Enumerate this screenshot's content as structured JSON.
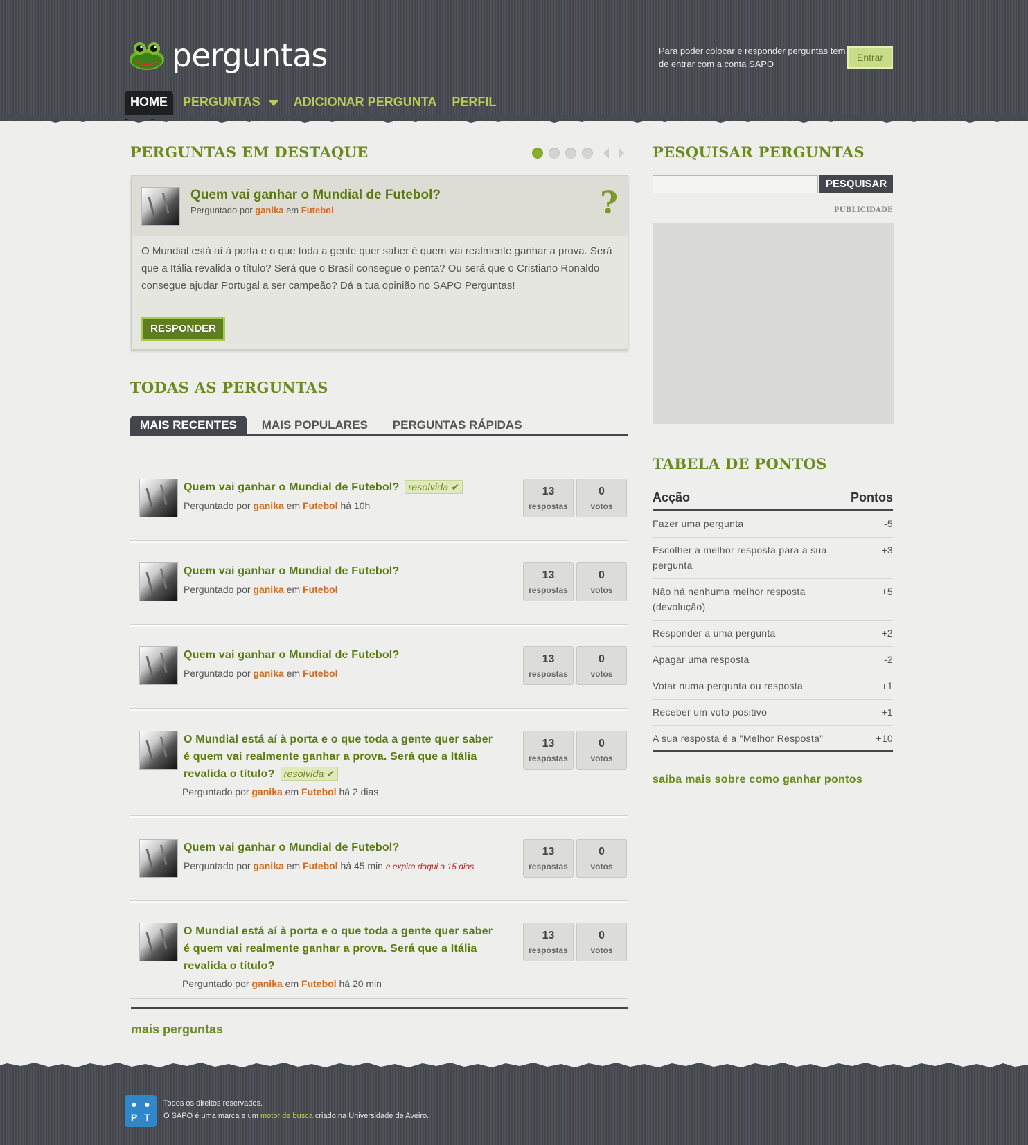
{
  "header": {
    "logo_text": "perguntas",
    "login_message": "Para poder colocar e responder perguntas tem de entrar com a conta SAPO",
    "login_button": "Entrar",
    "nav": [
      {
        "label": "HOME"
      },
      {
        "label": "PERGUNTAS"
      },
      {
        "label": "ADICIONAR PERGUNTA"
      },
      {
        "label": "PERFIL"
      }
    ]
  },
  "featured": {
    "section_title": "PERGUNTAS EM DESTAQUE",
    "title": "Quem vai ganhar o Mundial de Futebol?",
    "meta_prefix": "Perguntado por",
    "user": "ganika",
    "meta_in": "em",
    "category": "Futebol",
    "body": "O Mundial está aí à porta e o que toda a gente quer saber é quem vai realmente ganhar a prova. Será que a Itália revalida o título? Será que o Brasil consegue o penta? Ou será que o Cristiano Ronaldo consegue ajudar Portugal a ser campeão? Dá a tua opinião no SAPO Perguntas!",
    "button": "RESPONDER",
    "question_icon": "?"
  },
  "all_questions": {
    "section_title": "TODAS AS PERGUNTAS",
    "tabs": [
      {
        "label": "MAIS RECENTES"
      },
      {
        "label": "MAIS POPULARES"
      },
      {
        "label": "PERGUNTAS RÁPIDAS"
      }
    ],
    "questions": [
      {
        "title": "Quem vai ganhar o Mundial de Futebol?",
        "badge": "resolvida",
        "meta_prefix": "Perguntado por",
        "user": "ganika",
        "meta_in": "em",
        "category": "Futebol",
        "time": "há 10h",
        "expire": "",
        "answers": "13",
        "answers_label": "respostas",
        "votes": "0",
        "votes_label": "votos"
      },
      {
        "title": "Quem vai ganhar o Mundial de Futebol?",
        "badge": "",
        "meta_prefix": "Perguntado por",
        "user": "ganika",
        "meta_in": "em",
        "category": "Futebol",
        "time": "",
        "expire": "",
        "answers": "13",
        "answers_label": "respostas",
        "votes": "0",
        "votes_label": "votos"
      },
      {
        "title": "Quem vai ganhar o Mundial de Futebol?",
        "badge": "",
        "meta_prefix": "Perguntado por",
        "user": "ganika",
        "meta_in": "em",
        "category": "Futebol",
        "time": "",
        "expire": "",
        "answers": "13",
        "answers_label": "respostas",
        "votes": "0",
        "votes_label": "votos"
      },
      {
        "title": "O Mundial está aí à porta e o que toda a gente quer saber é quem vai realmente ganhar a prova. Será que a Itália revalida o título?",
        "badge": "resolvida",
        "meta_prefix": "Perguntado por",
        "user": "ganika",
        "meta_in": "em",
        "category": "Futebol",
        "time": "há 2 dias",
        "expire": "",
        "answers": "13",
        "answers_label": "respostas",
        "votes": "0",
        "votes_label": "votos"
      },
      {
        "title": "Quem vai ganhar o Mundial de Futebol?",
        "badge": "",
        "meta_prefix": "Perguntado por",
        "user": "ganika",
        "meta_in": "em",
        "category": "Futebol",
        "time": "há 45 min",
        "expire": "e expira daqui a 15 dias",
        "answers": "13",
        "answers_label": "respostas",
        "votes": "0",
        "votes_label": "votos"
      },
      {
        "title": "O Mundial está aí à porta e o que toda a gente quer saber é quem vai realmente ganhar a prova. Será que a Itália revalida o título?",
        "badge": "",
        "meta_prefix": "Perguntado por",
        "user": "ganika",
        "meta_in": "em",
        "category": "Futebol",
        "time": "há 20 min",
        "expire": "",
        "answers": "13",
        "answers_label": "respostas",
        "votes": "0",
        "votes_label": "votos"
      }
    ],
    "more_link": "mais perguntas"
  },
  "search": {
    "section_title": "PESQUISAR PERGUNTAS",
    "placeholder": "",
    "button": "PESQUISAR",
    "ad_label": "PUBLICIDADE"
  },
  "points": {
    "section_title": "TABELA DE PONTOS",
    "col_action": "Acção",
    "col_points": "Pontos",
    "rows": [
      {
        "action": "Fazer uma pergunta",
        "points": "-5"
      },
      {
        "action": "Escolher a melhor resposta para a sua pergunta",
        "points": "+3"
      },
      {
        "action": "Não há nenhuma melhor resposta (devolução)",
        "points": "+5"
      },
      {
        "action": "Responder a uma pergunta",
        "points": "+2"
      },
      {
        "action": "Apagar uma resposta",
        "points": "-2"
      },
      {
        "action": "Votar numa pergunta ou resposta",
        "points": "+1"
      },
      {
        "action": "Receber um voto positivo",
        "points": "+1"
      },
      {
        "action": "A sua resposta é a \"Melhor Resposta\"",
        "points": "+10"
      }
    ],
    "more_link": "saiba mais sobre como ganhar pontos"
  },
  "footer": {
    "logo_letters": [
      "",
      "",
      "P",
      "T"
    ],
    "line1": "Todos os direitos reservados.",
    "line2_a": "O SAPO é uma marca e um",
    "line2_link": "motor de busca",
    "line2_b": "criado na Universidade de Aveiro."
  },
  "colors": {
    "brand_green": "#6b8a1f",
    "header_dark": "#484a51",
    "user_orange": "#d46a1c",
    "login_button": "#c8dc8a"
  }
}
